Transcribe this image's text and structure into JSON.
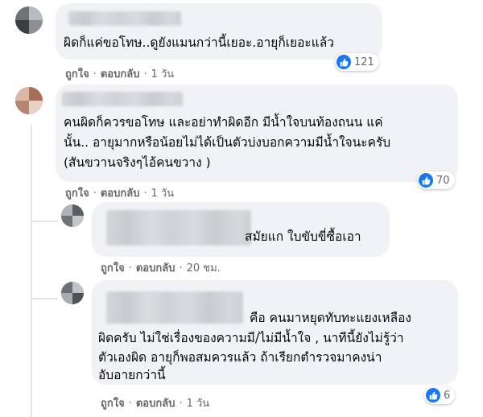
{
  "comments": [
    {
      "text_lines": [
        "ผิดก็แค่ขอโทษ..ดูยังแมนกว่านี้เยอะ.อายุก็เยอะแล้ว"
      ],
      "actions": {
        "like": "ถูกใจ",
        "reply": "ตอบกลับ",
        "time": "1 วัน"
      },
      "reaction_count": "121",
      "reaction_icon": "like-icon",
      "reaction_color": "#1877f2"
    },
    {
      "text_lines": [
        "คนผิดก็ควรขอโทษ และอย่าทำผิดอีก มีน้ำใจบนท้องถนน แค่",
        "นั้น.. อายุมากหรือน้อยไม่ได้เป็นตัวบ่งบอกความมีน้ำใจนะครับ",
        "(สันขวานจริงๆไอ้คนขวาง )"
      ],
      "actions": {
        "like": "ถูกใจ",
        "reply": "ตอบกลับ",
        "time": "1 วัน"
      },
      "reaction_count": "70",
      "reaction_icon": "like-icon",
      "reaction_color": "#1877f2"
    }
  ],
  "replies": [
    {
      "text_lines": [
        "สมัยแก ใบขับขี่ซื้อเอา"
      ],
      "actions": {
        "like": "ถูกใจ",
        "reply": "ตอบกลับ",
        "time": "20 ชม."
      }
    },
    {
      "text_lines": [
        "คือ คนมาหยุดทับทะแยงเหลือง",
        "ผิดครับ ไม่ใช่เรื่องของความมี/ไม่มีน้ำใจ , นาทีนี้ยังไม่รู้ว่า",
        "ตัวเองผิด อายุก็พอสมควรแล้ว ถ้าเรียกตำรวจมาคงน่า",
        "อับอายกว่านี้"
      ],
      "actions": {
        "like": "ถูกใจ",
        "reply": "ตอบกลับ",
        "time": "1 วัน"
      },
      "reaction_count": "6",
      "reaction_icon": "like-icon",
      "reaction_color": "#1877f2"
    }
  ],
  "colors": {
    "bubble_bg": "#f0f2f5",
    "secondary_text": "#65676b",
    "primary_text": "#050505",
    "like_blue": "#1877f2"
  }
}
